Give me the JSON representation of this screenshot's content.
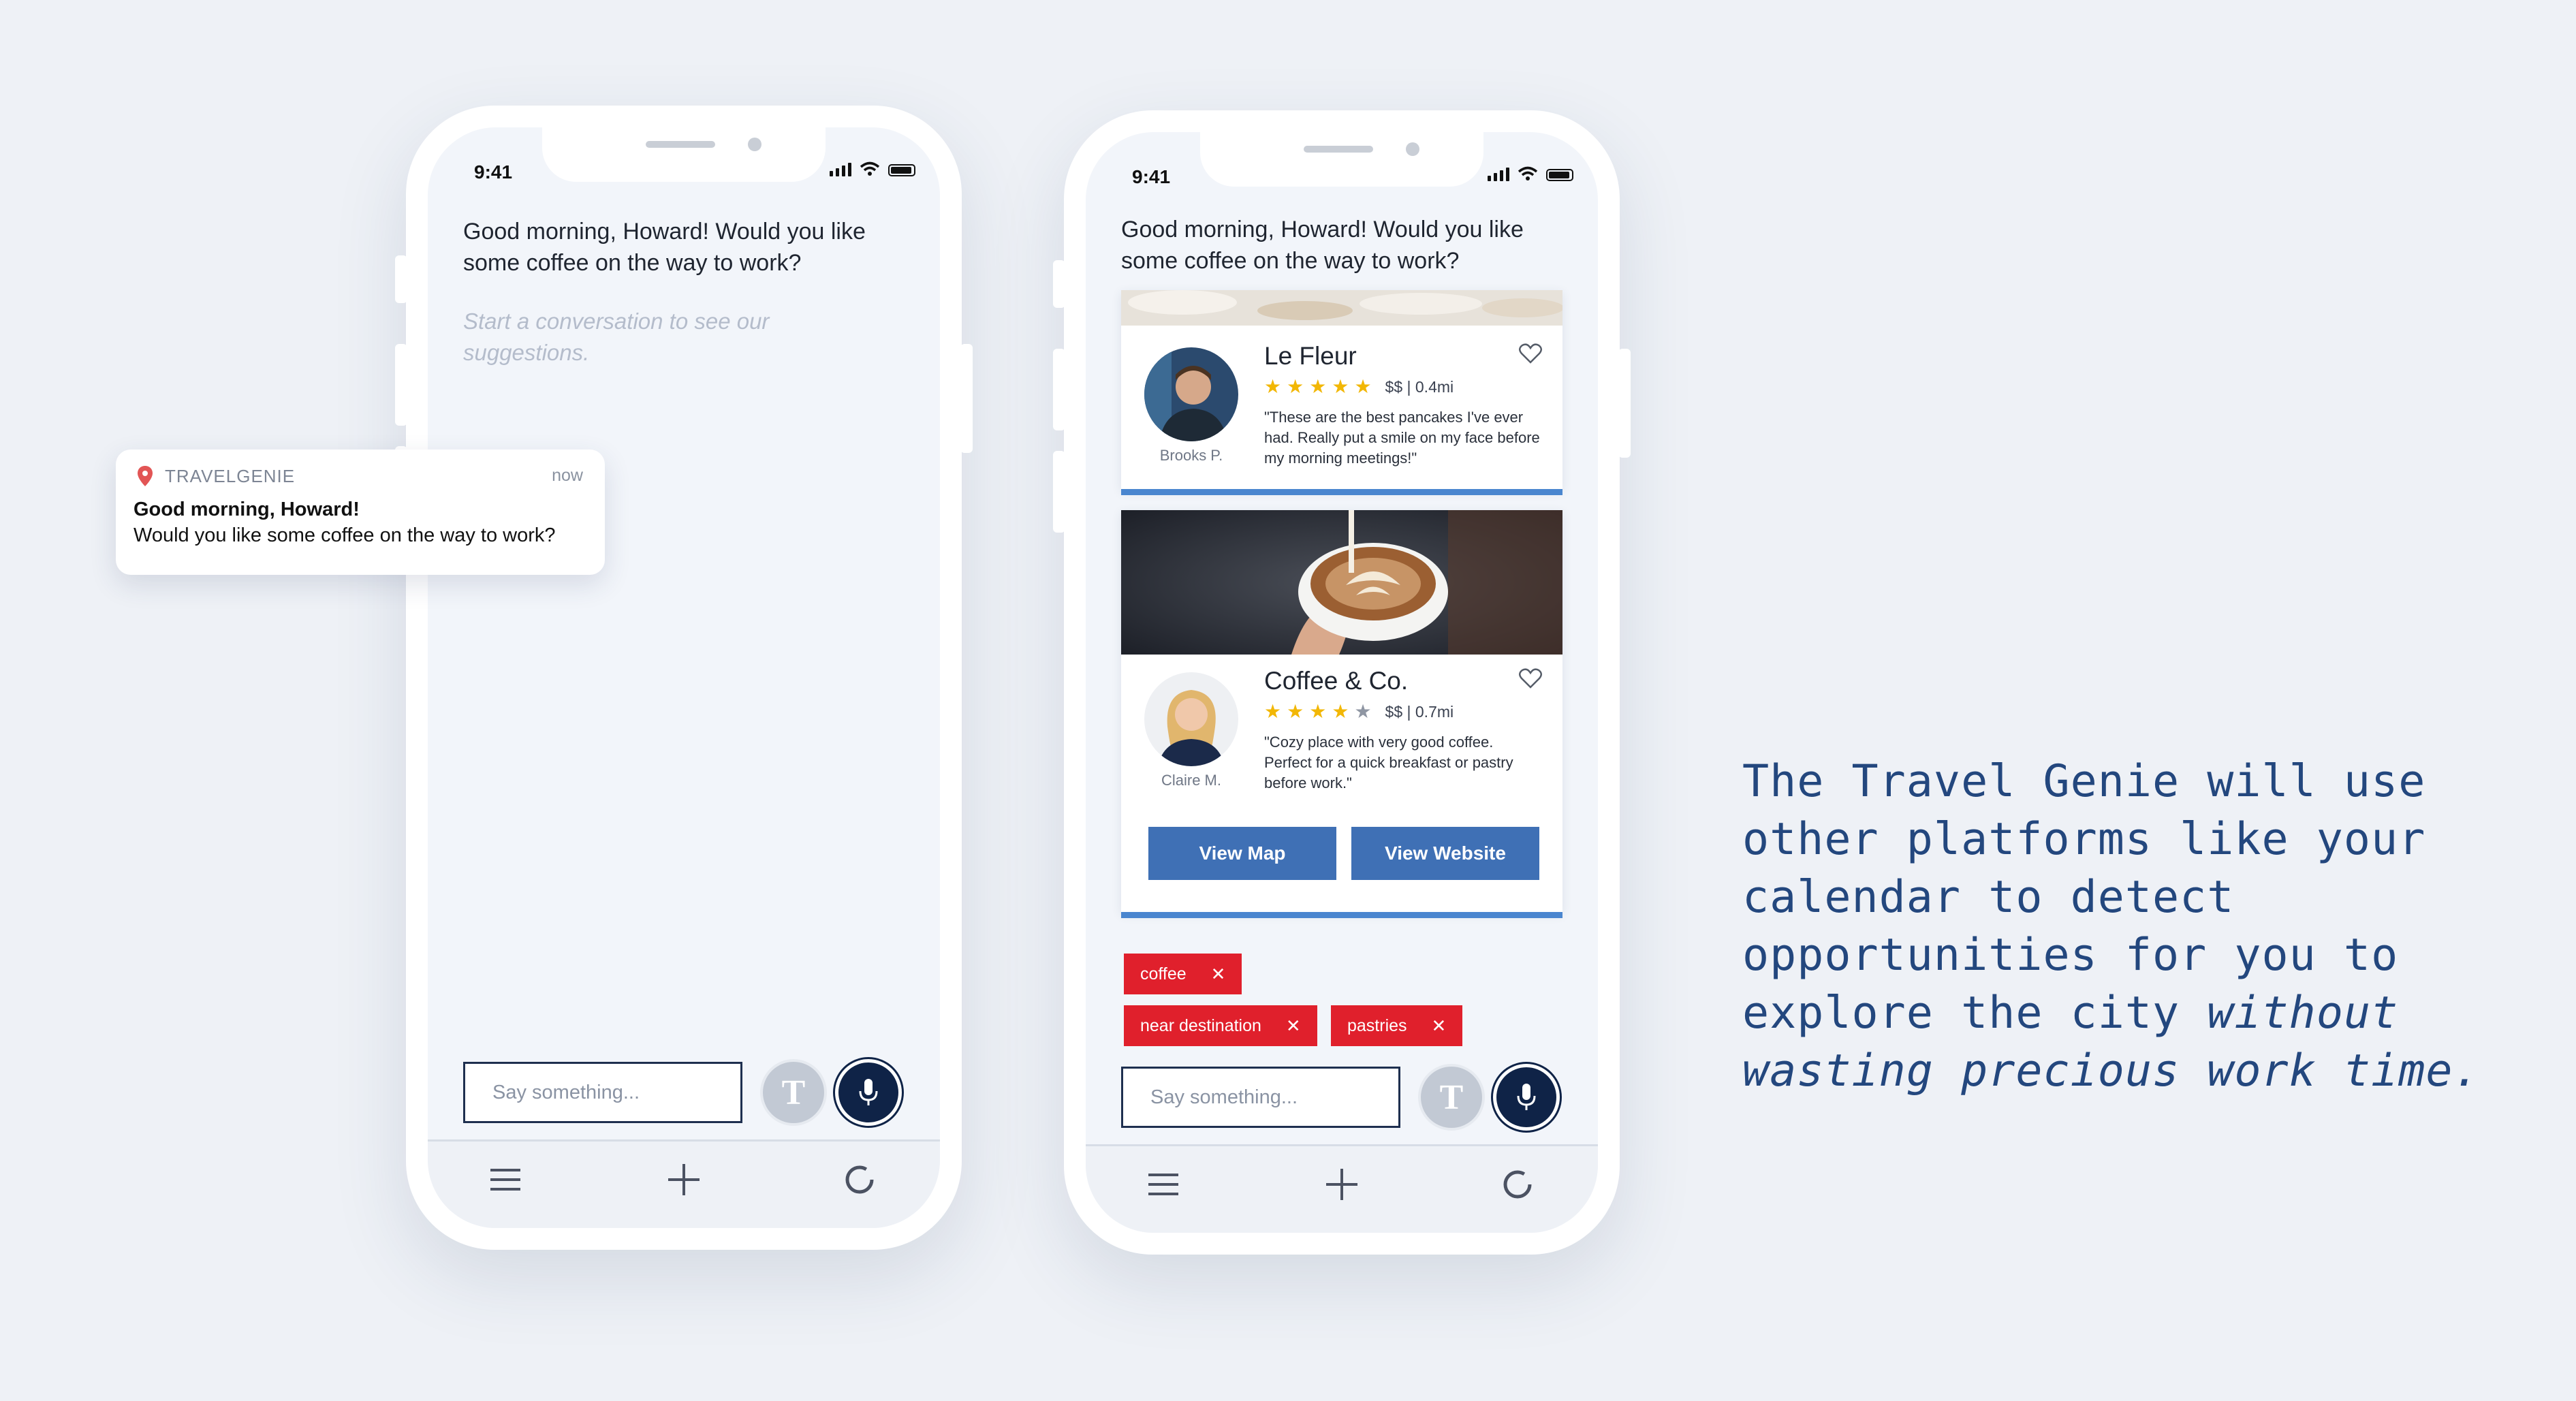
{
  "phone": {
    "time": "9:41",
    "greeting": "Good morning, Howard! Would you like some coffee on the way to work?",
    "empty_prompt": "Start a conversation to see our suggestions.",
    "input_placeholder": "Say something...",
    "text_button_glyph": "T",
    "icons": [
      "menu-icon",
      "plus-icon",
      "loading-icon",
      "mic-icon",
      "heart-icon",
      "close-icon",
      "location-pin-icon"
    ]
  },
  "notification": {
    "app_name": "TRAVELGENIE",
    "time": "now",
    "title": "Good morning, Howard!",
    "body": "Would you like some coffee on the way to work?"
  },
  "suggestions": [
    {
      "name": "Le Fleur",
      "rating": 5,
      "price": "$$",
      "distance": "0.4mi",
      "meta": "$$ | 0.4mi",
      "review": "\"These are the best pancakes I've ever had. Really put a smile on my face before my morning meetings!\"",
      "reviewer": "Brooks P."
    },
    {
      "name": "Coffee & Co.",
      "rating": 4,
      "price": "$$",
      "distance": "0.7mi",
      "meta": "$$ | 0.7mi",
      "review": "\"Cozy place with very good coffee. Perfect for a quick breakfast or pastry before work.\"",
      "reviewer": "Claire M.",
      "view_map_label": "View Map",
      "view_website_label": "View Website"
    }
  ],
  "tags": [
    "coffee",
    "near destination",
    "pastries"
  ],
  "tagline": {
    "regular": "The Travel Genie will use other platforms like your calendar to detect opportunities for you to explore the city",
    "italic": "without wasting precious work time."
  },
  "colors": {
    "background": "#eef1f6",
    "navy": "#0f2347",
    "button_blue": "#3f70b5",
    "accent_blue": "#4a86cf",
    "tag_red": "#e0202c",
    "star_gold": "#f2b705",
    "tagline_blue": "#23477e"
  }
}
